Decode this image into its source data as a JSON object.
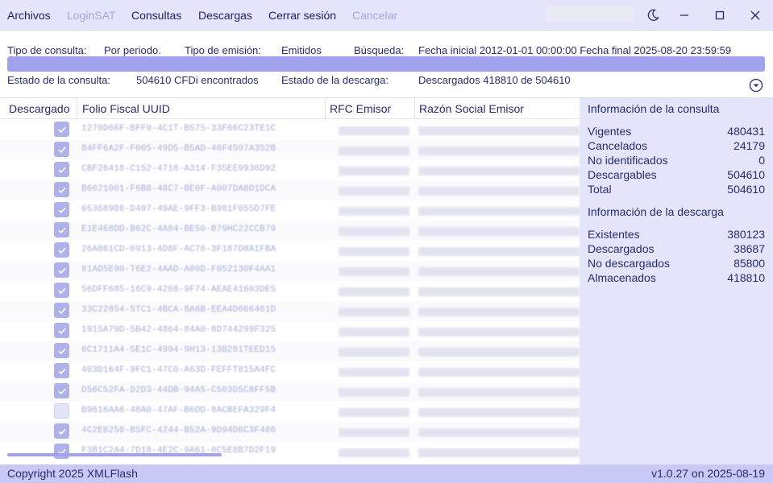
{
  "menu": {
    "items": [
      {
        "label": "Archivos",
        "enabled": true
      },
      {
        "label": "LoginSAT",
        "enabled": false
      },
      {
        "label": "Consultas",
        "enabled": true
      },
      {
        "label": "Descargas",
        "enabled": true
      },
      {
        "label": "Cerrar sesión",
        "enabled": true
      },
      {
        "label": "Cancelar",
        "enabled": false
      }
    ],
    "window_controls": [
      "moon-icon",
      "minimize-icon",
      "maximize-icon",
      "close-icon"
    ]
  },
  "query": {
    "tipo_label": "Tipo de consulta:",
    "tipo_value": "Por periodo.",
    "emision_label": "Tipo de emisión:",
    "emision_value": "Emitidos",
    "busqueda_label": "Búsqueda:",
    "busqueda_value": "Fecha inicial 2012-01-01 00:00:00 Fecha final 2025-08-20 23:59:59",
    "progress": 1.0,
    "estado_consulta_label": "Estado de la consulta:",
    "estado_consulta_value": "504610 CFDi encontrados",
    "estado_descarga_label": "Estado de la descarga:",
    "estado_descarga_value": "Descargados 418810 de 504610"
  },
  "table": {
    "headers": [
      "Descargado",
      "Folio Fiscal UUID",
      "RFC Emisor",
      "Razón Social Emisor"
    ],
    "rows": [
      {
        "checked": true,
        "uuid": "1270D66F-BFF9-4C1T-B575-33F66C23TE1C"
      },
      {
        "checked": true,
        "uuid": "84FF6A2F-F005-49D5-B5AD-46F4507A352B"
      },
      {
        "checked": true,
        "uuid": "CBF26418-C152-4718-A314-F35EE9936D92"
      },
      {
        "checked": true,
        "uuid": "B6621001-F6B8-48C7-BE0F-A007DA8D1DCA"
      },
      {
        "checked": true,
        "uuid": "65368986-D407-49AE-9FF3-B981F055D7FE"
      },
      {
        "checked": true,
        "uuid": "E1E468DD-B62C-4A84-BE50-B79HC22CCB79"
      },
      {
        "checked": true,
        "uuid": "26A861CD-6913-4D8F-AC76-3F187D8A1FBA"
      },
      {
        "checked": true,
        "uuid": "81AD5E90-T6E2-4AAD-A00D-F052130F4AA1"
      },
      {
        "checked": true,
        "uuid": "56DFF685-16C9-4268-9F74-AEAE41603DE5"
      },
      {
        "checked": true,
        "uuid": "33C22854-5TC1-4BCA-8A6B-EEA4D666461D"
      },
      {
        "checked": true,
        "uuid": "1915A79D-5B42-4864-84A0-8D744299F325"
      },
      {
        "checked": true,
        "uuid": "6C1711A4-5E1C-4994-9H13-13B281TEED15"
      },
      {
        "checked": true,
        "uuid": "403D164F-9FC1-47C0-A63D-FEFFT815A4FC"
      },
      {
        "checked": true,
        "uuid": "D56C52FA-D2D3-44DB-94A5-C503D5C8FF5B"
      },
      {
        "checked": false,
        "uuid": "B9616AA6-48A0-47AF-B6DD-8ACBEFA329F4"
      },
      {
        "checked": true,
        "uuid": "4C2E8258-B5FC-4244-B52A-9D94D6C3F486"
      },
      {
        "checked": true,
        "uuid": "F3B1C2A4-7D18-4E2C-9A61-0C5E8B7D2F19"
      }
    ]
  },
  "consulta_info": {
    "title": "Información de la consulta",
    "stats": [
      {
        "label": "Vigentes",
        "value": "480431"
      },
      {
        "label": "Cancelados",
        "value": "24179"
      },
      {
        "label": "No identificados",
        "value": "0"
      },
      {
        "label": "Descargables",
        "value": "504610"
      },
      {
        "label": "Total",
        "value": "504610"
      }
    ]
  },
  "descarga_info": {
    "title": "Información de la descarga",
    "stats": [
      {
        "label": "Existentes",
        "value": "380123"
      },
      {
        "label": "Descargados",
        "value": "38687"
      },
      {
        "label": "No descargados",
        "value": "85800"
      },
      {
        "label": "Almacenados",
        "value": "418810"
      }
    ]
  },
  "footer": {
    "copyright": "Copyright 2025 XMLFlash",
    "version": "v1.0.27 on 2025-08-19"
  },
  "colors": {
    "accent": "#a1a1ee",
    "menubar": "#e4e4fb",
    "footer": "#c9c9f5",
    "text": "#2b2b6e"
  }
}
